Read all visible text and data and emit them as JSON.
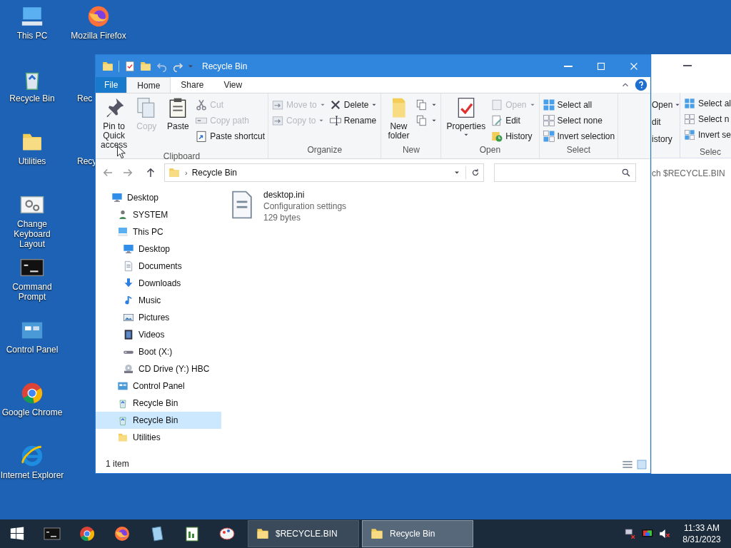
{
  "desktop": {
    "column_1": [
      {
        "label": "This PC"
      },
      {
        "label": "Recycle Bin"
      },
      {
        "label": "Utilities"
      },
      {
        "label": "Change Keyboard Layout"
      },
      {
        "label": "Command Prompt"
      },
      {
        "label": "Control Panel"
      },
      {
        "label": "Google Chrome"
      },
      {
        "label": "Internet Explorer"
      }
    ],
    "column_2": [
      {
        "label": "Mozilla Firefox"
      },
      {
        "label": "Rec"
      },
      {
        "label": "Recy"
      }
    ]
  },
  "background_window": {
    "open_group": [
      {
        "label": "Open",
        "dropdown": true
      },
      {
        "label": "dit",
        "dropdown": false
      },
      {
        "label": "istory",
        "dropdown": false
      }
    ],
    "select_group": [
      "Select al",
      "Select n",
      "Invert se"
    ],
    "select_label": "Selec",
    "search": {
      "placeholder": "ch $RECYCLE.BIN"
    }
  },
  "explorer": {
    "title": "Recycle Bin",
    "tabs": [
      {
        "label": "File",
        "selected": false,
        "kind": "file"
      },
      {
        "label": "Home",
        "selected": true,
        "kind": "tab"
      },
      {
        "label": "Share",
        "selected": false,
        "kind": "tab"
      },
      {
        "label": "View",
        "selected": false,
        "kind": "tab"
      }
    ],
    "ribbon": [
      {
        "label": "Clipboard",
        "items": [
          {
            "kind": "large",
            "label": "Pin to Quick access",
            "disabled": false
          },
          {
            "kind": "large",
            "label": "Copy",
            "disabled": true
          },
          {
            "kind": "large",
            "label": "Paste",
            "disabled": false
          },
          {
            "kind": "stack",
            "items": [
              {
                "label": "Cut",
                "disabled": true
              },
              {
                "label": "Copy path",
                "disabled": true
              },
              {
                "label": "Paste shortcut",
                "disabled": false
              }
            ]
          }
        ]
      },
      {
        "label": "Organize",
        "items": [
          {
            "kind": "stack",
            "items": [
              {
                "label": "Move to",
                "disabled": true,
                "dropdown": true
              },
              {
                "label": "Copy to",
                "disabled": true,
                "dropdown": true
              }
            ]
          },
          {
            "kind": "stack",
            "items": [
              {
                "label": "Delete",
                "disabled": false,
                "dropdown": true
              },
              {
                "label": "Rename",
                "disabled": false
              }
            ]
          }
        ]
      },
      {
        "label": "New",
        "items": [
          {
            "kind": "large",
            "label": "New folder",
            "disabled": false
          },
          {
            "kind": "stack",
            "items": [
              {
                "disabled": false,
                "dropdown": true
              },
              {
                "disabled": false,
                "dropdown": true
              }
            ]
          }
        ]
      },
      {
        "label": "Open",
        "items": [
          {
            "kind": "large",
            "label": "Properties",
            "disabled": false,
            "dropdown": true
          },
          {
            "kind": "stack",
            "items": [
              {
                "label": "Open",
                "disabled": true,
                "dropdown": true
              },
              {
                "label": "Edit",
                "disabled": false
              },
              {
                "label": "History",
                "disabled": false
              }
            ]
          }
        ]
      },
      {
        "label": "Select",
        "items": [
          {
            "kind": "stack",
            "items": [
              {
                "label": "Select all",
                "disabled": false
              },
              {
                "label": "Select none",
                "disabled": false
              },
              {
                "label": "Invert selection",
                "disabled": false
              }
            ]
          }
        ]
      }
    ],
    "address": {
      "separator": "›",
      "path": "Recycle Bin"
    },
    "nav": [
      {
        "label": "Desktop",
        "selected": false,
        "children": [
          {
            "label": "SYSTEM",
            "selected": false
          },
          {
            "label": "This PC",
            "selected": false,
            "children": [
              {
                "label": "Desktop",
                "selected": false
              },
              {
                "label": "Documents",
                "selected": false
              },
              {
                "label": "Downloads",
                "selected": false
              },
              {
                "label": "Music",
                "selected": false
              },
              {
                "label": "Pictures",
                "selected": false
              },
              {
                "label": "Videos",
                "selected": false
              },
              {
                "label": "Boot (X:)",
                "selected": false
              },
              {
                "label": "CD Drive (Y:) HBC",
                "selected": false
              }
            ]
          },
          {
            "label": "Control Panel",
            "selected": false
          },
          {
            "label": "Recycle Bin",
            "selected": false
          },
          {
            "label": "Recycle Bin",
            "selected": true
          },
          {
            "label": "Utilities",
            "selected": false
          }
        ]
      }
    ],
    "files": [
      {
        "name": "desktop.ini",
        "type": "Configuration settings",
        "size": "129 bytes"
      }
    ],
    "status": "1 item"
  },
  "taskbar": {
    "windows": [
      {
        "label": "$RECYCLE.BIN",
        "selected": false
      },
      {
        "label": "Recycle Bin",
        "selected": true
      }
    ],
    "time": "11:33 AM",
    "date": "8/31/2023"
  }
}
